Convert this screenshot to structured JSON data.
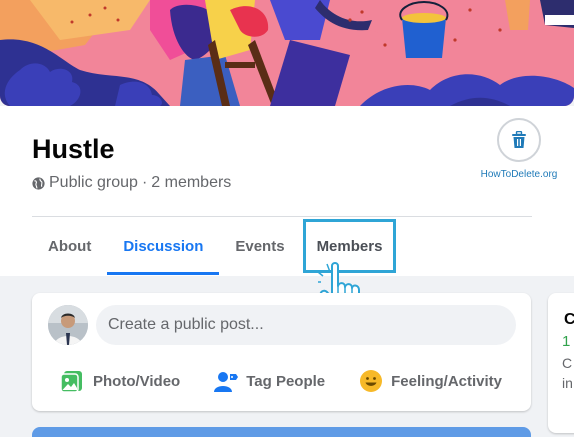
{
  "group": {
    "title": "Hustle",
    "privacy": "Public group",
    "separator": "·",
    "members": "2 members"
  },
  "brand": {
    "text": "HowToDelete.org",
    "icon": "trash-icon"
  },
  "tabs": [
    {
      "label": "About"
    },
    {
      "label": "Discussion"
    },
    {
      "label": "Events"
    },
    {
      "label": "Members"
    }
  ],
  "composer": {
    "placeholder": "Create a public post...",
    "actions": [
      {
        "label": "Photo/Video",
        "icon": "photo-icon"
      },
      {
        "label": "Tag People",
        "icon": "tag-people-icon"
      },
      {
        "label": "Feeling/Activity",
        "icon": "feeling-icon"
      }
    ]
  },
  "side": {
    "line1": "C",
    "line2": "1",
    "line3": "C",
    "line4": "in"
  },
  "colors": {
    "accent": "#1877f2",
    "highlight": "#2fa5d6",
    "green": "#31a24c"
  }
}
